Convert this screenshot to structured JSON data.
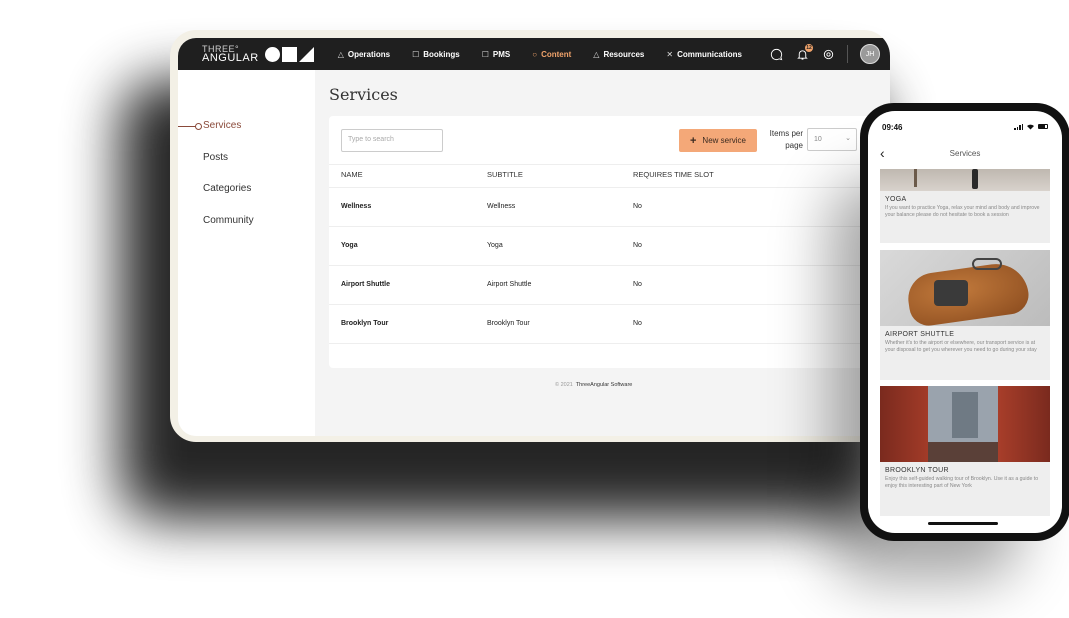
{
  "brand": {
    "line1": "THREE°",
    "line2": "ANGULAR"
  },
  "nav": [
    {
      "label": "Operations",
      "glyph": "△"
    },
    {
      "label": "Bookings",
      "glyph": "☐"
    },
    {
      "label": "PMS",
      "glyph": "☐"
    },
    {
      "label": "Content",
      "glyph": "○"
    },
    {
      "label": "Resources",
      "glyph": "△"
    },
    {
      "label": "Communications",
      "glyph": "✕"
    }
  ],
  "topbar": {
    "notification_count": "12",
    "avatar_initials": "JH"
  },
  "sidebar": {
    "items": [
      "Services",
      "Posts",
      "Categories",
      "Community"
    ]
  },
  "page": {
    "title": "Services",
    "search_placeholder": "Type to search",
    "new_button": "New service",
    "items_per_page_label": "Items per page",
    "items_per_page_value": "10"
  },
  "table": {
    "headers": [
      "NAME",
      "SUBTITLE",
      "REQUIRES TIME SLOT"
    ],
    "rows": [
      [
        "Wellness",
        "Wellness",
        "No"
      ],
      [
        "Yoga",
        "Yoga",
        "No"
      ],
      [
        "Airport Shuttle",
        "Airport Shuttle",
        "No"
      ],
      [
        "Brooklyn Tour",
        "Brooklyn Tour",
        "No"
      ]
    ],
    "row_menu": "•••"
  },
  "footer": {
    "copyright": "© 2021",
    "company": "ThreeAngular Software"
  },
  "phone": {
    "time": "09:46",
    "title": "Services",
    "cards": [
      {
        "title": "YOGA",
        "desc": "If you want to practice Yoga, relax your mind and body and improve your balance please do not hesitate to book a session"
      },
      {
        "title": "AIRPORT SHUTTLE",
        "desc": "Whether it's to the airport or elsewhere, our transport service is at your disposal to get you wherever you need to go during your stay"
      },
      {
        "title": "BROOKLYN  TOUR",
        "desc": "Enjoy this self-guided walking tour of Brooklyn. Use it as a guide to enjoy this interesting part of  New York"
      }
    ]
  },
  "colors": {
    "accent": "#f4a878",
    "active_nav": "#f0a36b",
    "active_side": "#8a4a3a",
    "topbar": "#1f1f1f"
  }
}
